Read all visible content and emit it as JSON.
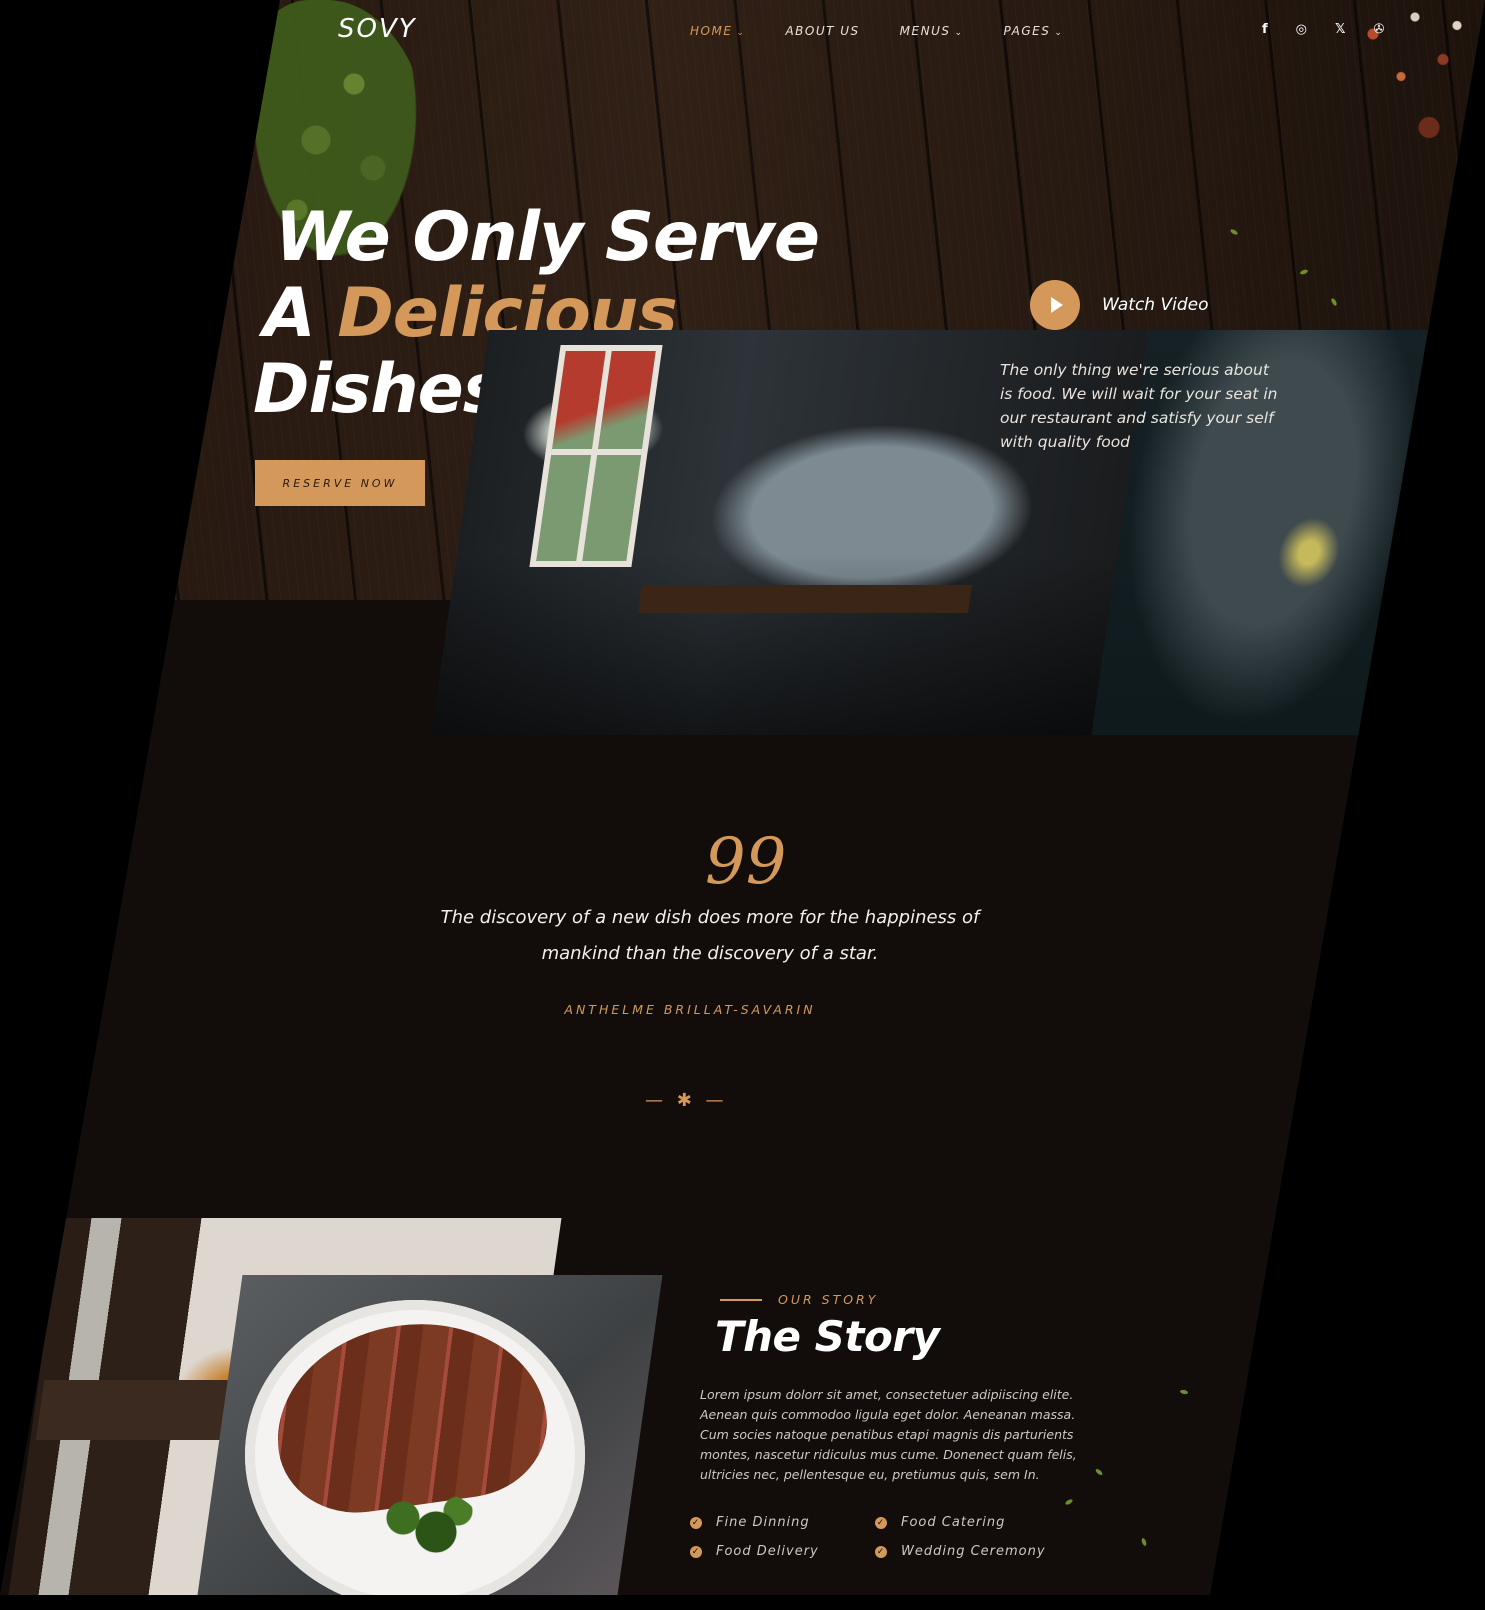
{
  "brand": {
    "logo": "SOVY"
  },
  "nav": {
    "items": [
      {
        "label": "HOME",
        "active": true,
        "has_dropdown": true
      },
      {
        "label": "ABOUT US",
        "active": false,
        "has_dropdown": false
      },
      {
        "label": "MENUS",
        "active": false,
        "has_dropdown": true
      },
      {
        "label": "PAGES",
        "active": false,
        "has_dropdown": true
      }
    ],
    "social": [
      "facebook-icon",
      "instagram-icon",
      "x-icon",
      "tripadvisor-icon"
    ],
    "social_glyphs": [
      "f",
      "◎",
      "𝕏",
      "✇"
    ]
  },
  "hero": {
    "line1": "We Only Serve",
    "line2_prefix": "A ",
    "line2_highlight": "Delicious",
    "line3": "Dishes",
    "cta_label": "RESERVE NOW",
    "watch_label": "Watch Video",
    "blurb": "The only thing we're serious about is food. We will wait for your seat in our restaurant and satisfy your self with quality food"
  },
  "quote": {
    "mark": "99",
    "text": "The discovery of a new dish does more for the happiness of mankind than the discovery of a star.",
    "author": "ANTHELME BRILLAT-SAVARIN",
    "divider": "— ✱ —"
  },
  "story": {
    "eyebrow": "OUR STORY",
    "title": "The Story",
    "body": "Lorem ipsum dolorr sit amet, consectetuer adipiiscing elite. Aenean quis commodoo ligula eget dolor. Aeneanan massa. Cum socies natoque penatibus etapi magnis dis parturients montes, nascetur ridiculus mus cume. Donenect quam felis, ultricies nec, pellentesque eu, pretiumus quis, sem In.",
    "features": [
      "Fine Dinning",
      "Food Catering",
      "Food Delivery",
      "Wedding Ceremony"
    ]
  },
  "colors": {
    "accent": "#d4995a",
    "background": "#120d0b"
  }
}
